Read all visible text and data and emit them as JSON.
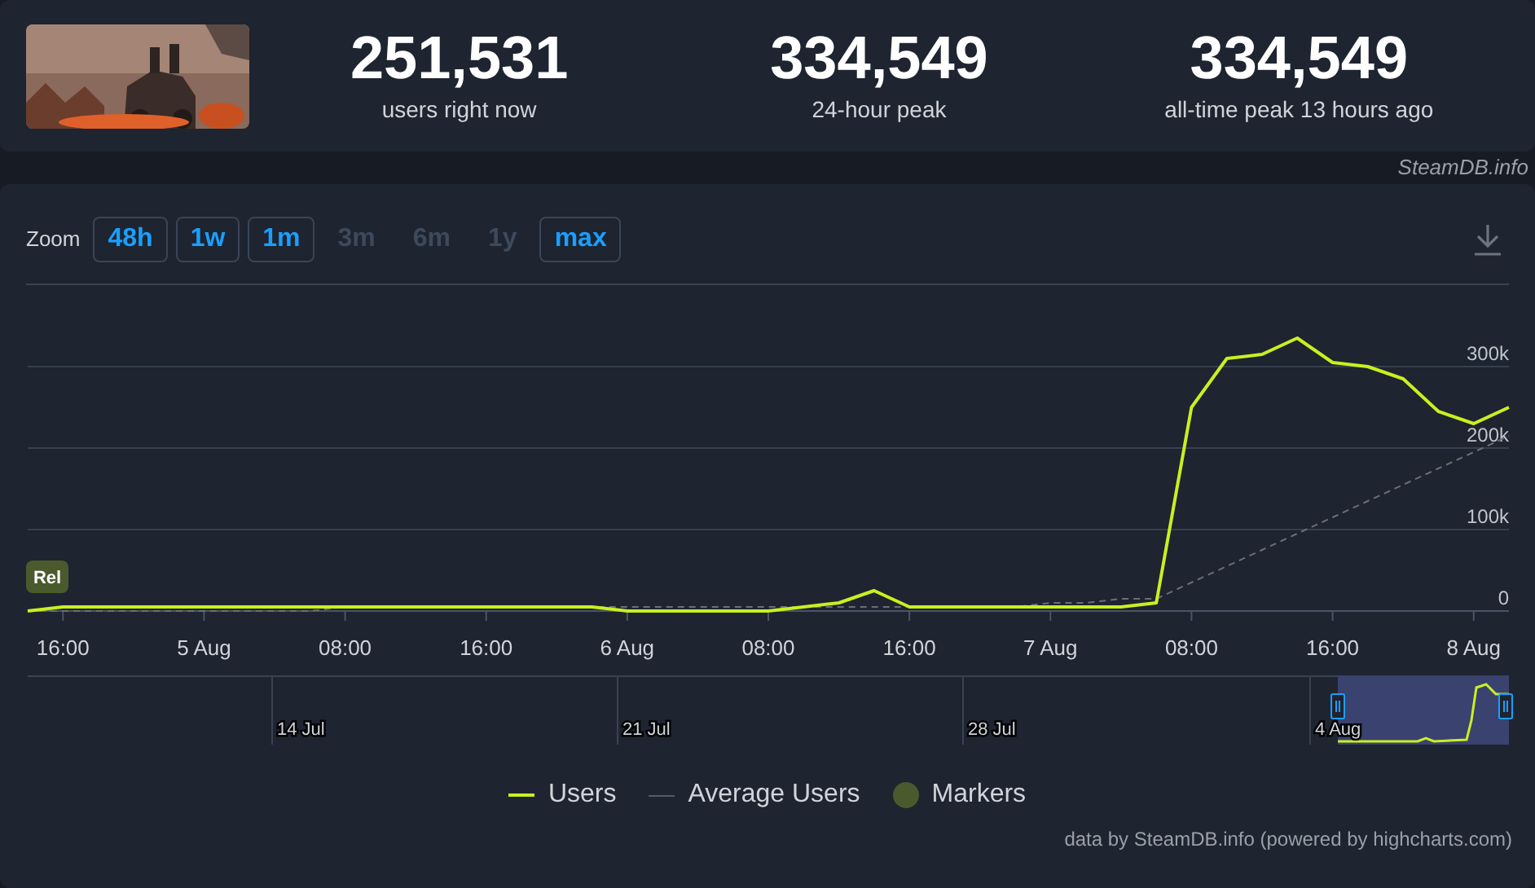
{
  "header": {
    "stats": [
      {
        "value": "251,531",
        "label": "users right now"
      },
      {
        "value": "334,549",
        "label": "24-hour peak"
      },
      {
        "value": "334,549",
        "label": "all-time peak 13 hours ago"
      }
    ],
    "source": "SteamDB.info"
  },
  "zoom": {
    "label": "Zoom",
    "buttons": [
      {
        "label": "48h",
        "disabled": false
      },
      {
        "label": "1w",
        "disabled": false
      },
      {
        "label": "1m",
        "disabled": false
      },
      {
        "label": "3m",
        "disabled": true
      },
      {
        "label": "6m",
        "disabled": true
      },
      {
        "label": "1y",
        "disabled": true
      },
      {
        "label": "max",
        "disabled": false
      }
    ]
  },
  "chart": {
    "chart_data": {
      "type": "line",
      "categories": [
        null,
        "16:00",
        null,
        null,
        null,
        "5 Aug",
        null,
        null,
        null,
        "08:00",
        null,
        null,
        null,
        "16:00",
        null,
        null,
        null,
        "6 Aug",
        null,
        null,
        null,
        "08:00",
        null,
        null,
        null,
        "16:00",
        null,
        null,
        null,
        "7 Aug",
        null,
        null,
        null,
        "08:00",
        null,
        null,
        null,
        "16:00",
        null,
        null,
        null,
        "8 Aug",
        null
      ],
      "series": [
        {
          "name": "Users",
          "color": "#c8f020",
          "values": [
            0,
            5000,
            5000,
            5000,
            5000,
            5000,
            5000,
            5000,
            5000,
            5000,
            5000,
            5000,
            5000,
            5000,
            5000,
            5000,
            5000,
            0,
            0,
            0,
            0,
            0,
            5000,
            10000,
            25000,
            5000,
            5000,
            5000,
            5000,
            5000,
            5000,
            5000,
            10000,
            250000,
            310000,
            315000,
            335000,
            305000,
            300000,
            285000,
            245000,
            230000,
            250000
          ]
        },
        {
          "name": "Average Users",
          "color": "#6b6f75",
          "line_style": "dashed",
          "values": [
            0,
            0,
            0,
            0,
            0,
            0,
            0,
            0,
            0,
            5000,
            5000,
            5000,
            5000,
            5000,
            5000,
            5000,
            5000,
            5000,
            5000,
            5000,
            5000,
            5000,
            5000,
            5000,
            5000,
            5000,
            5000,
            5000,
            5000,
            10000,
            10000,
            15000,
            15000,
            35000,
            55000,
            75000,
            95000,
            115000,
            135000,
            155000,
            175000,
            195000,
            215000
          ]
        }
      ],
      "ylim": [
        0,
        524000
      ],
      "grid": true,
      "yticks": [
        {
          "value": 0,
          "label": "0"
        },
        {
          "value": 100000,
          "label": "100k"
        },
        {
          "value": 200000,
          "label": "200k"
        },
        {
          "value": 300000,
          "label": "300k"
        }
      ],
      "annotations": [
        "Rel"
      ]
    }
  },
  "navigator": {
    "labels": [
      "14 Jul",
      "21 Jul",
      "28 Jul",
      "4 Aug"
    ]
  },
  "legend": {
    "markers": {
      "label": "Markers",
      "color": "#4a5a2c"
    }
  },
  "credit": "data by SteamDB.info (powered by highcharts.com)"
}
